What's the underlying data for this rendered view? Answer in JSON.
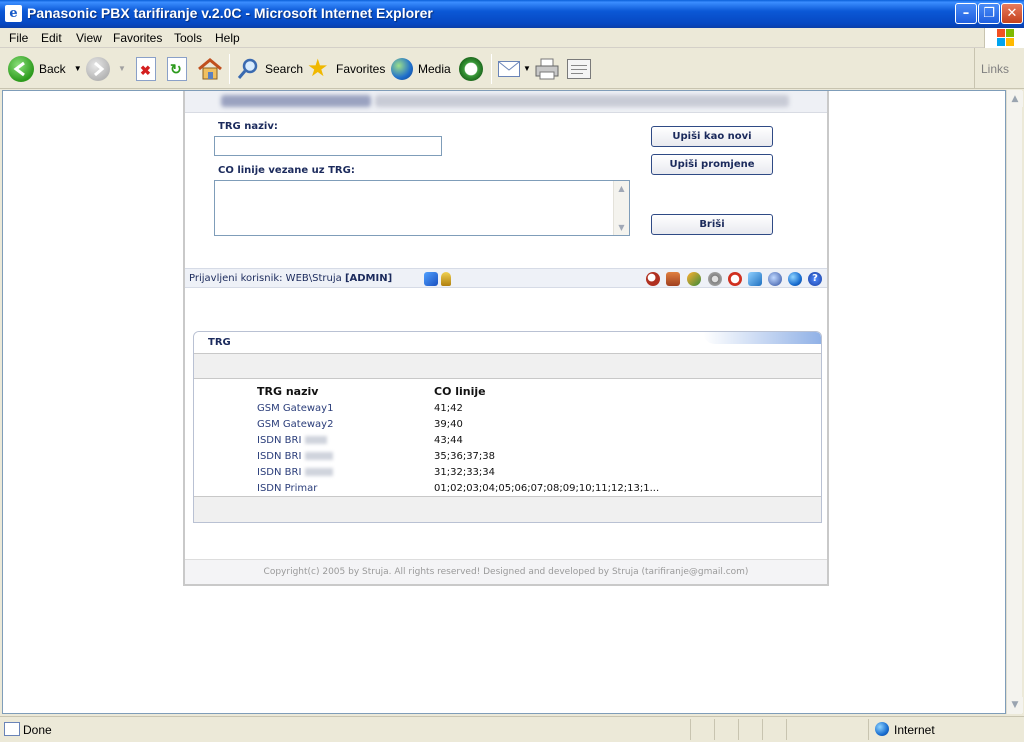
{
  "window": {
    "title": "Panasonic PBX tarifiranje v.2.0C - Microsoft Internet Explorer"
  },
  "menu": [
    "File",
    "Edit",
    "View",
    "Favorites",
    "Tools",
    "Help"
  ],
  "toolbar": {
    "back": "Back",
    "search": "Search",
    "favorites": "Favorites",
    "media": "Media",
    "links": "Links"
  },
  "form": {
    "trg_label": "TRG naziv:",
    "trg_value": "",
    "co_label": "CO linije vezane uz TRG:",
    "co_value": "",
    "btn_new": "Upiši kao novi",
    "btn_save": "Upiši promjene",
    "btn_delete": "Briši"
  },
  "userbar": {
    "prefix": "Prijavljeni korisnik: WEB\\Struja",
    "role": "[ADMIN]"
  },
  "trg_panel": {
    "title": "TRG",
    "columns": [
      "TRG naziv",
      "CO linije"
    ],
    "rows": [
      {
        "name": "GSM Gateway1",
        "co": "41;42"
      },
      {
        "name": "GSM Gateway2",
        "co": "39;40"
      },
      {
        "name": "ISDN BRI",
        "co": "43;44"
      },
      {
        "name": "ISDN BRI",
        "co": "35;36;37;38"
      },
      {
        "name": "ISDN BRI",
        "co": "31;32;33;34"
      },
      {
        "name": "ISDN Primar",
        "co": "01;02;03;04;05;06;07;08;09;10;11;12;13;1..."
      }
    ]
  },
  "footer": {
    "copyright": "Copyright(c) 2005 by Struja. All rights reserved! Designed and developed by Struja (tarifiranje@gmail.com)"
  },
  "status": {
    "text": "Done",
    "zone": "Internet"
  }
}
